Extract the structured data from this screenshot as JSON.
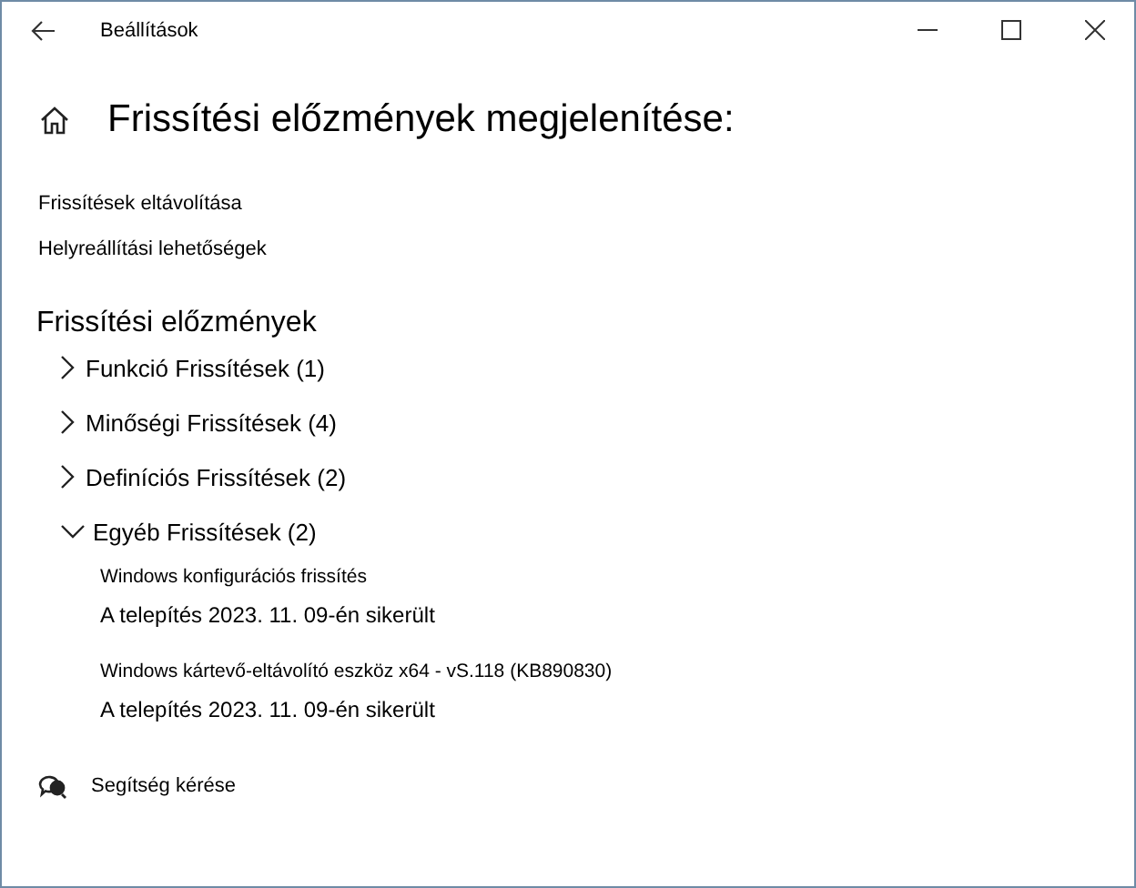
{
  "window": {
    "title": "Beállítások"
  },
  "page": {
    "title": "Frissítési előzmények megjelenítése:"
  },
  "links": [
    "Frissítések eltávolítása",
    "Helyreállítási lehetőségek"
  ],
  "history": {
    "title": "Frissítési előzmények",
    "groups": [
      {
        "label": "Funkció Frissítések (1)",
        "expanded": false
      },
      {
        "label": "Minőségi Frissítések (4)",
        "expanded": false
      },
      {
        "label": "Definíciós Frissítések (2)",
        "expanded": false
      },
      {
        "label": "Egyéb Frissítések (2)",
        "expanded": true,
        "children": [
          {
            "name": "Windows konfigurációs frissítés",
            "status": "A telepítés 2023. 11. 09-én sikerült"
          },
          {
            "name": "Windows kártevő-eltávolító eszköz x64 - vS.118 (KB890830)",
            "status": "A telepítés 2023. 11. 09-én sikerült"
          }
        ]
      }
    ]
  },
  "help": {
    "label": "Segítség kérése"
  }
}
